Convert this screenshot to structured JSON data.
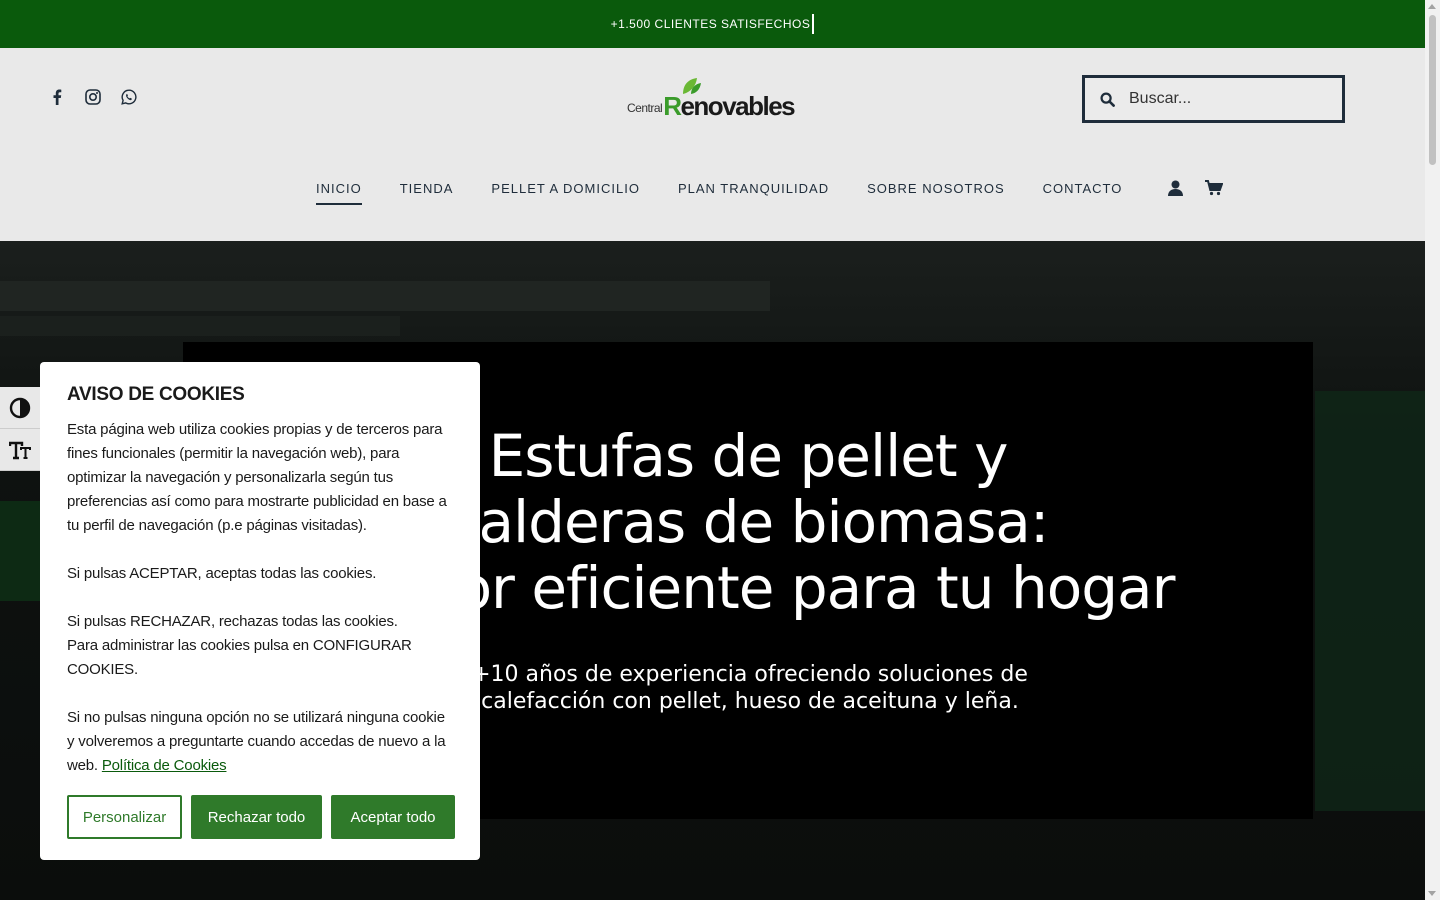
{
  "topbar": {
    "text": "+1.500 CLIENTES SATISFECHOS"
  },
  "header": {
    "logo_small": "Central",
    "logo_main_first": "R",
    "logo_main_rest": "enovables",
    "social_icons": [
      "facebook-icon",
      "instagram-icon",
      "whatsapp-icon"
    ],
    "search": {
      "placeholder": "Buscar..."
    }
  },
  "nav": {
    "items": [
      {
        "label": "INICIO",
        "active": true
      },
      {
        "label": "TIENDA"
      },
      {
        "label": "PELLET A DOMICILIO"
      },
      {
        "label": "PLAN TRANQUILIDAD"
      },
      {
        "label": "SOBRE NOSOTROS"
      },
      {
        "label": "CONTACTO"
      }
    ],
    "icons": [
      "user-icon",
      "cart-icon"
    ]
  },
  "hero": {
    "title_line1": "Estufas de pellet y",
    "title_line2": "calderas de biomasa:",
    "title_line3": "or eficiente para tu hogar",
    "subtitle_line1": "+10 años de experiencia ofreciendo soluciones de",
    "subtitle_line2": "calefacción con pellet, hueso de aceituna y leña."
  },
  "accessibility": {
    "icons": [
      "contrast-toggle-icon",
      "font-size-icon"
    ]
  },
  "cookie": {
    "title": "AVISO DE COOKIES",
    "p1": "Esta página web utiliza cookies propias y de terceros para fines funcionales (permitir la navegación web), para optimizar la navegación y personalizarla según tus preferencias así como para mostrarte publicidad en base a tu perfil de navegación (p.e páginas visitadas).",
    "p2": "Si pulsas ACEPTAR, aceptas todas las cookies.",
    "p3a": "Si pulsas RECHAZAR, rechazas todas las cookies.",
    "p3b": "Para administrar las cookies pulsa en CONFIGURAR COOKIES.",
    "p4": "Si no pulsas ninguna opción no se utilizará ninguna cookie y volveremos a preguntarte cuando accedas de nuevo a la web.",
    "policy_link": "Política de Cookies",
    "buttons": {
      "customize": "Personalizar",
      "reject": "Rechazar todo",
      "accept": "Aceptar todo"
    }
  },
  "colors": {
    "brand_green": "#0a5a0c",
    "button_green": "#2f7a2a",
    "nav_text": "#1f2d3b"
  }
}
